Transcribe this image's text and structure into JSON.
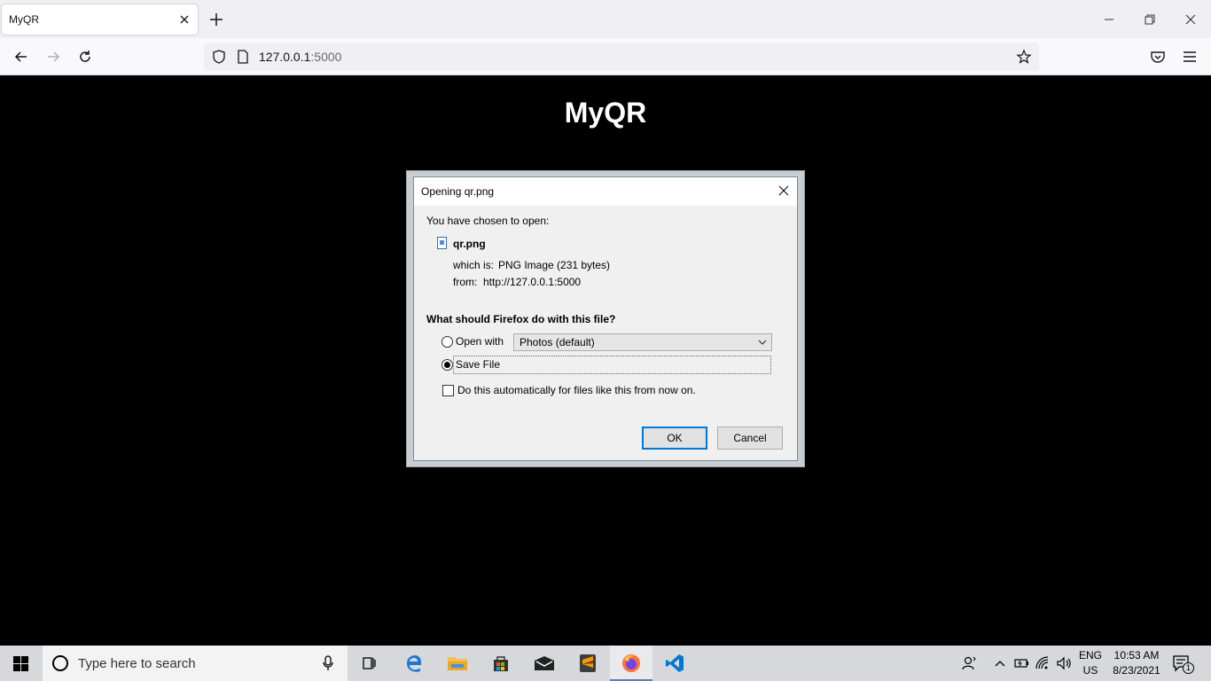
{
  "browser": {
    "tab_title": "MyQR",
    "url_host": "127.0.0.1",
    "url_port": ":5000"
  },
  "page": {
    "title": "MyQR"
  },
  "dialog": {
    "title": "Opening qr.png",
    "intro": "You have chosen to open:",
    "filename": "qr.png",
    "which_is_label": "which is:",
    "which_is_value": "PNG Image (231 bytes)",
    "from_label": "from:",
    "from_value": "http://127.0.0.1:5000",
    "question": "What should Firefox do with this file?",
    "open_with_label": "Open with",
    "open_with_selected": "Photos (default)",
    "save_file_label": "Save File",
    "auto_label": "Do this automatically for files like this from now on.",
    "ok_label": "OK",
    "cancel_label": "Cancel",
    "selected_option": "save_file",
    "auto_checked": false
  },
  "taskbar": {
    "search_placeholder": "Type here to search",
    "apps": [
      "task-view",
      "edge",
      "file-explorer",
      "microsoft-store",
      "mail",
      "sublime-text",
      "firefox",
      "vscode"
    ],
    "active_app": "firefox",
    "lang_top": "ENG",
    "lang_bottom": "US",
    "time": "10:53 AM",
    "date": "8/23/2021",
    "notification_count": "1"
  },
  "colors": {
    "page_bg": "#000000",
    "accent": "#0078d7",
    "taskbar_bg": "#d6d8dc"
  }
}
